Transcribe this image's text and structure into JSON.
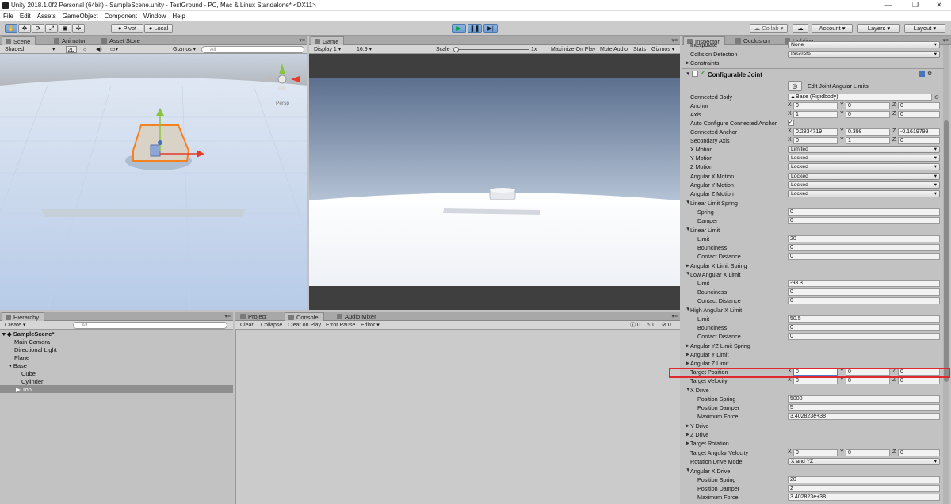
{
  "window": {
    "title": "Unity 2018.1.0f2 Personal (64bit) - SampleScene.unity - TestGround - PC, Mac & Linux Standalone* <DX11>",
    "min": "—",
    "max": "❐",
    "close": "✕"
  },
  "menu": [
    "File",
    "Edit",
    "Assets",
    "GameObject",
    "Component",
    "Window",
    "Help"
  ],
  "toolbar": {
    "pivot": "Pivot",
    "local": "Local",
    "collab": "Collab",
    "account": "Account",
    "layers": "Layers",
    "layout": "Layout"
  },
  "scene": {
    "tabs": [
      "Scene",
      "Animator",
      "Asset Store"
    ],
    "shading": "Shaded",
    "mode2d": "2D",
    "gizmos": "Gizmos",
    "search_ph": "All",
    "persp": "Persp"
  },
  "game": {
    "tab": "Game",
    "display": "Display 1",
    "aspect": "16:9",
    "scale_label": "Scale",
    "scale_val": "1x",
    "buttons": [
      "Maximize On Play",
      "Mute Audio",
      "Stats",
      "Gizmos"
    ]
  },
  "hierarchy": {
    "tab": "Hierarchy",
    "create": "Create",
    "search_ph": "All",
    "scene_name": "SampleScene*",
    "items": [
      "Main Camera",
      "Directional Light",
      "Plane",
      "Base",
      "Cube",
      "Cylinder",
      "Top"
    ]
  },
  "console": {
    "tabs": [
      "Project",
      "Console",
      "Audio Mixer"
    ],
    "buttons": [
      "Clear",
      "Collapse",
      "Clear on Play",
      "Error Pause",
      "Editor"
    ],
    "counts": [
      "0",
      "0",
      "0"
    ]
  },
  "inspector": {
    "tabs": [
      "Inspector",
      "Occlusion",
      "Lighting"
    ],
    "top_rows": [
      {
        "label": "Interpolate",
        "value": "None"
      },
      {
        "label": "Collision Detection",
        "value": "Discrete"
      },
      {
        "label": "Constraints",
        "value": ""
      }
    ],
    "component_title": "Configurable Joint",
    "edit_limits": "Edit Joint Angular Limits",
    "connected_body": {
      "label": "Connected Body",
      "value": "Base (Rigidbody)"
    },
    "vec_rows": [
      {
        "label": "Anchor",
        "x": "0",
        "y": "0",
        "z": "0"
      },
      {
        "label": "Axis",
        "x": "1",
        "y": "0",
        "z": "0"
      }
    ],
    "auto_anchor": "Auto Configure Connected Anchor",
    "vec_rows2": [
      {
        "label": "Connected Anchor",
        "x": "0.2834719",
        "y": "0.398",
        "z": "-0.1619799"
      },
      {
        "label": "Secondary Axis",
        "x": "0",
        "y": "1",
        "z": "0"
      }
    ],
    "motions": [
      {
        "label": "X Motion",
        "value": "Limited"
      },
      {
        "label": "Y Motion",
        "value": "Locked"
      },
      {
        "label": "Z Motion",
        "value": "Locked"
      },
      {
        "label": "Angular X Motion",
        "value": "Locked"
      },
      {
        "label": "Angular Y Motion",
        "value": "Locked"
      },
      {
        "label": "Angular Z Motion",
        "value": "Locked"
      }
    ],
    "lls": {
      "title": "Linear Limit Spring",
      "spring": "Spring",
      "spring_v": "0",
      "damper": "Damper",
      "damper_v": "0"
    },
    "ll": {
      "title": "Linear Limit",
      "limit": "Limit",
      "limit_v": "20",
      "bounce": "Bounciness",
      "bounce_v": "0",
      "cd": "Contact Distance",
      "cd_v": "0"
    },
    "axls": "Angular X Limit Spring",
    "lax": {
      "title": "Low Angular X Limit",
      "limit_v": "-93.3",
      "bounce_v": "0",
      "cd_v": "0"
    },
    "hax": {
      "title": "High Angular X Limit",
      "limit_v": "50.5",
      "bounce_v": "0",
      "cd_v": "0"
    },
    "collapsed1": [
      "Angular YZ Limit Spring",
      "Angular Y Limit",
      "Angular Z Limit"
    ],
    "target_pos": {
      "label": "Target Position",
      "x": "0",
      "y": "0",
      "z": "0"
    },
    "target_vel": {
      "label": "Target Velocity",
      "x": "0",
      "y": "0",
      "z": "0"
    },
    "xdrive": {
      "title": "X Drive",
      "ps": "Position Spring",
      "ps_v": "5000",
      "pd": "Position Damper",
      "pd_v": "5",
      "mf": "Maximum Force",
      "mf_v": "3.402823e+38"
    },
    "collapsed2": [
      "Y Drive",
      "Z Drive",
      "Target Rotation"
    ],
    "tav": {
      "label": "Target Angular Velocity",
      "x": "0",
      "y": "0",
      "z": "0"
    },
    "rdm": {
      "label": "Rotation Drive Mode",
      "value": "X and YZ"
    },
    "axdrive": {
      "title": "Angular X Drive",
      "ps_v": "20",
      "pd_v": "2",
      "mf_v": "3.402823e+38"
    }
  }
}
